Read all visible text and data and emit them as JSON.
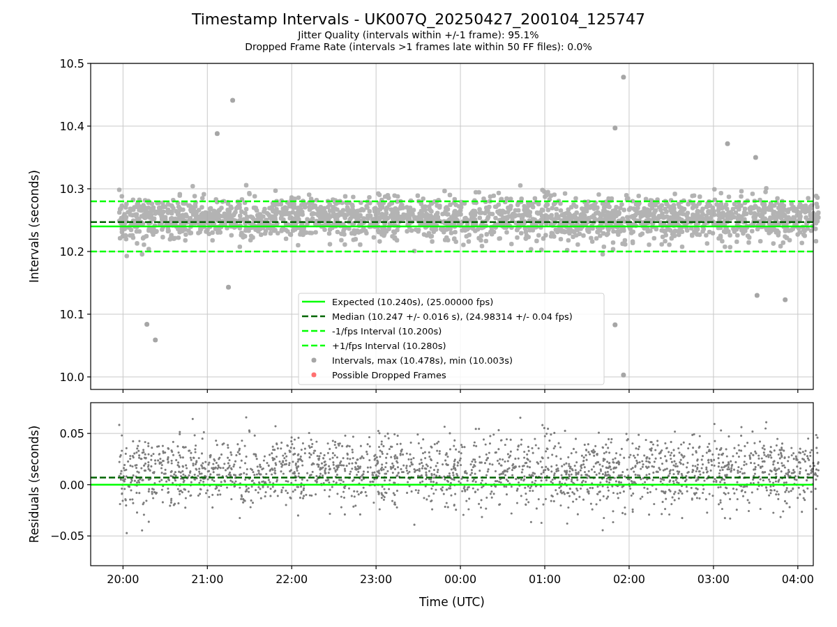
{
  "figure": {
    "title": "Timestamp Intervals - UK007Q_20250427_200104_125747",
    "subtitles": [
      "Jitter Quality (intervals within +/-1 frame): 95.1%",
      "Dropped Frame Rate (intervals >1 frames late within 50 FF files): 0.0%"
    ]
  },
  "intervals_plot": {
    "chart_data": {
      "type": "scatter",
      "ylabel": "Intervals (seconds)",
      "xlim": [
        "2025-04-27T19:37",
        "2025-04-28T04:11"
      ],
      "ylim": [
        9.98,
        10.5
      ],
      "grid": true,
      "legend": "lower center",
      "yticks": [
        {
          "value": 10.0,
          "label": "10.0"
        },
        {
          "value": 10.1,
          "label": "10.1"
        },
        {
          "value": 10.2,
          "label": "10.2"
        },
        {
          "value": 10.3,
          "label": "10.3"
        },
        {
          "value": 10.4,
          "label": "10.4"
        },
        {
          "value": 10.5,
          "label": "10.5"
        }
      ],
      "series": [
        {
          "name": "Expected (10.240s), (25.00000 fps)",
          "type": "line",
          "line_style": "solid",
          "color": "#00ff00",
          "x": [
            "2025-04-27T19:37",
            "2025-04-28T04:11"
          ],
          "values": [
            10.24,
            10.24
          ]
        },
        {
          "name": "Median (10.247 +/- 0.016 s), (24.98314 +/- 0.04 fps)",
          "type": "line",
          "line_style": "dashed",
          "color": "#006400",
          "x": [
            "2025-04-27T19:37",
            "2025-04-28T04:11"
          ],
          "values": [
            10.247,
            10.247
          ]
        },
        {
          "name": "-1/fps Interval (10.200s)",
          "type": "line",
          "line_style": "dashed",
          "color": "#00ff00",
          "x": [
            "2025-04-27T19:37",
            "2025-04-28T04:11"
          ],
          "values": [
            10.2,
            10.2
          ]
        },
        {
          "name": "+1/fps Interval (10.280s)",
          "type": "line",
          "line_style": "dashed",
          "color": "#00ff00",
          "x": [
            "2025-04-27T19:37",
            "2025-04-28T04:11"
          ],
          "values": [
            10.28,
            10.28
          ]
        },
        {
          "name": "Intervals, max (10.478s), min (10.003s)",
          "type": "scatter",
          "color": "#a6a6a6",
          "x": [
            "2025-04-27T21:07",
            "2025-04-27T21:18",
            "2025-04-27T20:17",
            "2025-04-27T20:23",
            "2025-04-27T21:15",
            "2025-04-28T01:56",
            "2025-04-28T01:50",
            "2025-04-28T01:50",
            "2025-04-28T01:56",
            "2025-04-28T03:10",
            "2025-04-28T03:31",
            "2025-04-28T03:51",
            "2025-04-28T03:30"
          ],
          "values": [
            10.388,
            10.441,
            10.084,
            10.059,
            10.143,
            10.478,
            10.397,
            10.083,
            10.003,
            10.372,
            10.13,
            10.123,
            10.35
          ]
        },
        {
          "name": "Possible Dropped Frames",
          "type": "scatter",
          "color": "#ff7070"
        }
      ]
    }
  },
  "residuals_plot": {
    "chart_data": {
      "type": "scatter",
      "xlabel": "Time (UTC)",
      "ylabel": "Residuals (seconds)",
      "xlim": [
        "2025-04-27T19:37",
        "2025-04-28T04:11"
      ],
      "ylim": [
        -0.079,
        0.08
      ],
      "grid": true,
      "xticks": [
        {
          "value": "2025-04-27T20:00",
          "label": "20:00"
        },
        {
          "value": "2025-04-27T21:00",
          "label": "21:00"
        },
        {
          "value": "2025-04-27T22:00",
          "label": "22:00"
        },
        {
          "value": "2025-04-27T23:00",
          "label": "23:00"
        },
        {
          "value": "2025-04-28T00:00",
          "label": "00:00"
        },
        {
          "value": "2025-04-28T01:00",
          "label": "01:00"
        },
        {
          "value": "2025-04-28T02:00",
          "label": "02:00"
        },
        {
          "value": "2025-04-28T03:00",
          "label": "03:00"
        },
        {
          "value": "2025-04-28T04:00",
          "label": "04:00"
        }
      ],
      "yticks": [
        {
          "value": -0.05,
          "label": "−0.05"
        },
        {
          "value": 0,
          "label": "0.00"
        },
        {
          "value": 0.05,
          "label": "0.05"
        }
      ],
      "series": [
        {
          "type": "line",
          "line_style": "solid",
          "color": "#00ff00",
          "x": [
            "2025-04-27T19:37",
            "2025-04-28T04:11"
          ],
          "values": [
            0,
            0
          ]
        },
        {
          "type": "line",
          "line_style": "dashed",
          "color": "#006400",
          "x": [
            "2025-04-27T19:37",
            "2025-04-28T04:11"
          ],
          "values": [
            0.007,
            0.007
          ]
        }
      ]
    }
  }
}
